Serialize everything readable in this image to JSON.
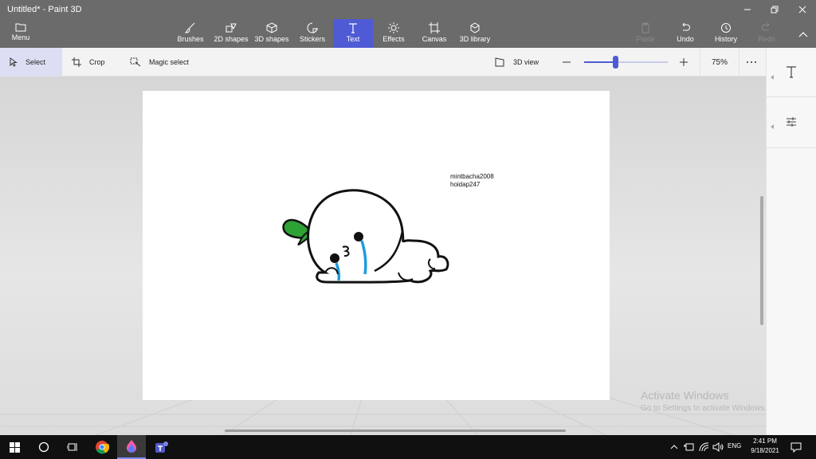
{
  "window": {
    "title": "Untitled* - Paint 3D"
  },
  "ribbon": {
    "menu_label": "Menu",
    "tools": [
      {
        "label": "Brushes",
        "icon": "brush-icon"
      },
      {
        "label": "2D shapes",
        "icon": "2d-shapes-icon"
      },
      {
        "label": "3D shapes",
        "icon": "3d-shapes-icon"
      },
      {
        "label": "Stickers",
        "icon": "sticker-icon"
      },
      {
        "label": "Text",
        "icon": "text-icon",
        "active": true
      },
      {
        "label": "Effects",
        "icon": "effects-icon"
      },
      {
        "label": "Canvas",
        "icon": "canvas-icon"
      },
      {
        "label": "3D library",
        "icon": "3d-library-icon"
      }
    ],
    "paste_label": "Paste",
    "undo_label": "Undo",
    "history_label": "History",
    "redo_label": "Redo"
  },
  "toolbar": {
    "select_label": "Select",
    "crop_label": "Crop",
    "magic_select_label": "Magic select",
    "view3d_label": "3D view",
    "zoom_value": "75%",
    "zoom_slider_fraction": 0.37
  },
  "canvas": {
    "text_line1": "mintbacha2008",
    "text_line2": "hoidap247"
  },
  "watermark": {
    "line1": "Activate Windows",
    "line2": "Go to Settings to activate Windows."
  },
  "taskbar": {
    "language": "ENG",
    "time": "2:41 PM",
    "date": "9/18/2021"
  },
  "colors": {
    "accent": "#4f5bd5",
    "ribbon_bg": "#6b6b6b",
    "sprout_green": "#2fa236",
    "tear_blue": "#1e9be0"
  }
}
